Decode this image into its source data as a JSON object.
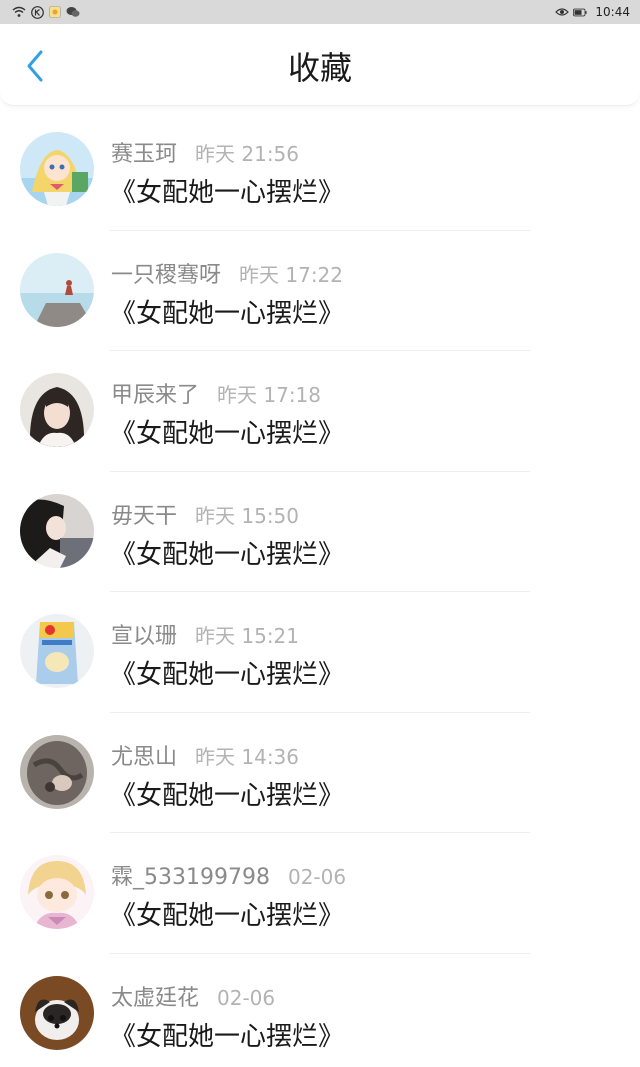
{
  "status_bar": {
    "time": "10:44",
    "left_icons": [
      "wifi-icon",
      "k-app-icon",
      "weather-app-icon",
      "wechat-icon"
    ],
    "right_icons": [
      "eye-icon",
      "battery-icon"
    ]
  },
  "header": {
    "title": "收藏",
    "back_icon": "chevron-left-icon",
    "accent_color": "#2f9fe6"
  },
  "items": [
    {
      "username": "赛玉珂",
      "time": "昨天 21:56",
      "title": "《女配她一心摆烂》"
    },
    {
      "username": "一只稷骞呀",
      "time": "昨天 17:22",
      "title": "《女配她一心摆烂》"
    },
    {
      "username": "甲辰来了",
      "time": "昨天 17:18",
      "title": "《女配她一心摆烂》"
    },
    {
      "username": "毋天干",
      "time": "昨天 15:50",
      "title": "《女配她一心摆烂》"
    },
    {
      "username": "宣以珊",
      "time": "昨天 15:21",
      "title": "《女配她一心摆烂》"
    },
    {
      "username": "尤思山",
      "time": "昨天 14:36",
      "title": "《女配她一心摆烂》"
    },
    {
      "username": "霖_533199798",
      "time": "02-06",
      "title": "《女配她一心摆烂》"
    },
    {
      "username": "太虚廷花",
      "time": "02-06",
      "title": "《女配她一心摆烂》"
    }
  ]
}
